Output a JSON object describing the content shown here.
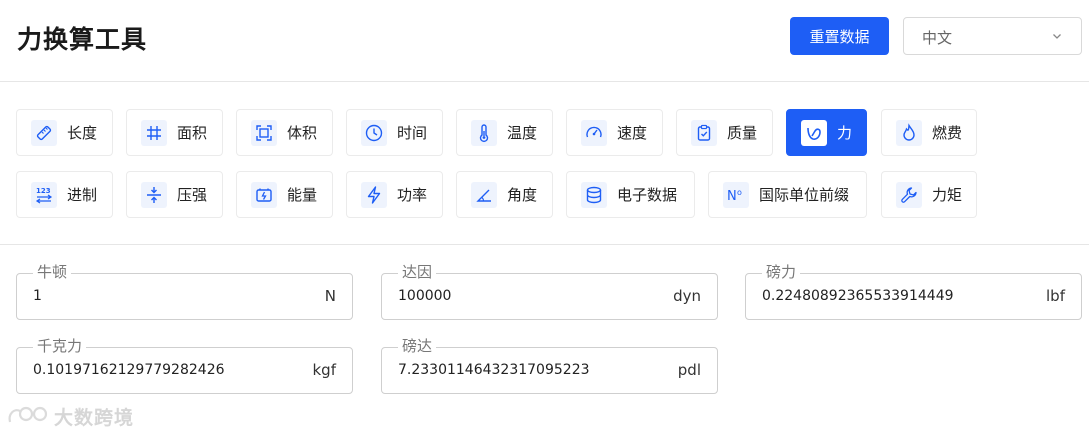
{
  "header": {
    "title": "力换算工具",
    "reset_label": "重置数据",
    "language": {
      "selected": "中文"
    }
  },
  "categories": [
    {
      "label": "长度",
      "icon": "ruler-icon",
      "active": false
    },
    {
      "label": "面积",
      "icon": "hash-icon",
      "active": false
    },
    {
      "label": "体积",
      "icon": "frame-icon",
      "active": false
    },
    {
      "label": "时间",
      "icon": "clock-icon",
      "active": false
    },
    {
      "label": "温度",
      "icon": "thermometer-icon",
      "active": false
    },
    {
      "label": "速度",
      "icon": "speedometer-icon",
      "active": false
    },
    {
      "label": "质量",
      "icon": "clipboard-icon",
      "active": false
    },
    {
      "label": "力",
      "icon": "force-icon",
      "active": true
    },
    {
      "label": "燃费",
      "icon": "flame-icon",
      "active": false
    },
    {
      "label": "进制",
      "icon": "number-base-icon",
      "active": false
    },
    {
      "label": "压强",
      "icon": "compress-icon",
      "active": false
    },
    {
      "label": "能量",
      "icon": "battery-icon",
      "active": false
    },
    {
      "label": "功率",
      "icon": "lightning-icon",
      "active": false
    },
    {
      "label": "角度",
      "icon": "angle-icon",
      "active": false
    },
    {
      "label": "电子数据",
      "icon": "database-icon",
      "active": false
    },
    {
      "label": "国际单位前缀",
      "icon": "numero-icon",
      "active": false
    },
    {
      "label": "力矩",
      "icon": "wrench-icon",
      "active": false
    }
  ],
  "fields": [
    {
      "label": "牛顿",
      "value": "1",
      "unit": "N"
    },
    {
      "label": "达因",
      "value": "100000",
      "unit": "dyn"
    },
    {
      "label": "磅力",
      "value": "0.22480892365533914449",
      "unit": "lbf"
    },
    {
      "label": "千克力",
      "value": "0.10197162129779282426",
      "unit": "kgf"
    },
    {
      "label": "磅达",
      "value": "7.23301146432317095223",
      "unit": "pdl"
    }
  ],
  "watermark": {
    "text": "大数跨境"
  },
  "colors": {
    "accent": "#1e5ef5",
    "icon_bg": "#eef3fd",
    "border": "#ebebeb"
  }
}
